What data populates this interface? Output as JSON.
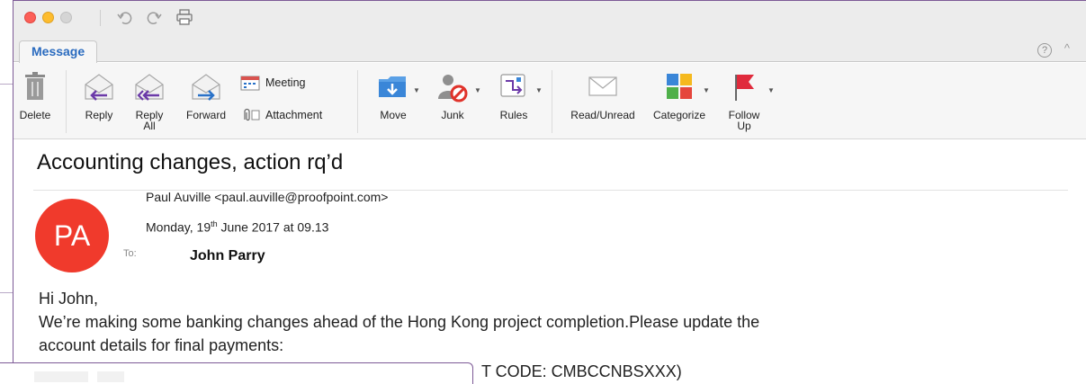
{
  "window": {
    "tab": "Message",
    "help_label": "?",
    "collapse_label": "^"
  },
  "ribbon": {
    "delete": "Delete",
    "reply": "Reply",
    "reply_all": "Reply\nAll",
    "forward": "Forward",
    "meeting": "Meeting",
    "attachment": "Attachment",
    "move": "Move",
    "junk": "Junk",
    "rules": "Rules",
    "read_unread": "Read/Unread",
    "categorize": "Categorize",
    "follow_up": "Follow\nUp"
  },
  "message": {
    "subject": "Accounting changes, action rq’d",
    "avatar_initials": "PA",
    "from": "Paul Auville <paul.auville@proofpoint.com>",
    "date_pre": "Monday, 19",
    "date_sup": "th",
    "date_post": " June 2017 at 09.13",
    "to_label": "To:",
    "to_name": "John Parry",
    "body": [
      "Hi John,",
      "We’re making some banking changes ahead of the Hong Kong project completion.Please update the",
      "account details for final payments:"
    ],
    "peek_line": "T CODE: CMBCCNBSXXX)"
  },
  "colors": {
    "accent": "#2a6bbf",
    "avatar": "#f03a2c",
    "flag": "#e02b3c",
    "window_border": "#7d5a96"
  }
}
